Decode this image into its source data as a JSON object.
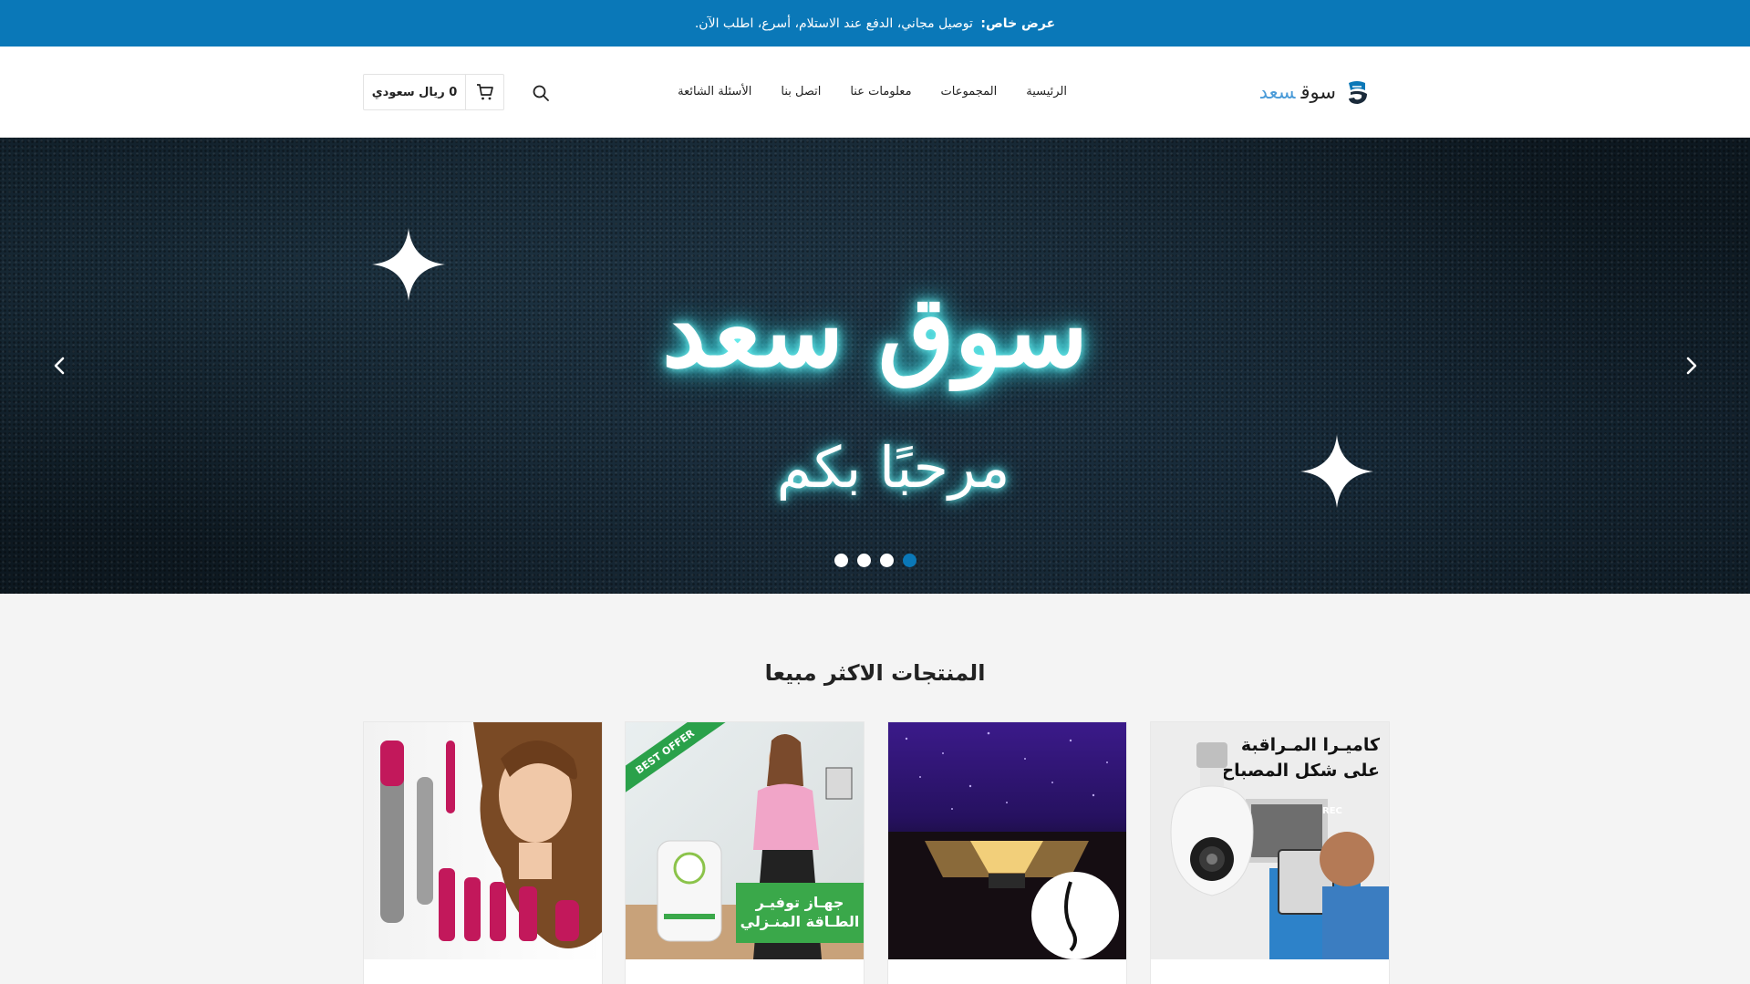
{
  "announcement": {
    "prefix": "عرض خاص:",
    "text": " توصيل مجاني، الدفع عند الاستلام، أسرع، اطلب الآن."
  },
  "logo": {
    "word1": "سوق",
    "word2": "سعد"
  },
  "nav": {
    "items": [
      {
        "label": "الرئيسية"
      },
      {
        "label": "المجموعات"
      },
      {
        "label": "معلومات عنا"
      },
      {
        "label": "اتصل بنا"
      },
      {
        "label": "الأسئلة الشائعة"
      }
    ]
  },
  "cart": {
    "total": "0 ريال سعودي"
  },
  "hero": {
    "title": "سوق سعد",
    "subtitle": "مرحبًا بكم",
    "slides_count": 4,
    "active_slide": 4
  },
  "best_sellers": {
    "title": "المنتجات الاكثر مبيعا",
    "products": [
      {
        "image_text_line1": "كاميـرا المـراقبة",
        "image_text_line2": "على شكل المصباح",
        "badge": "REC"
      },
      {
        "image_text": ""
      },
      {
        "ribbon": "BEST OFFER",
        "image_text_line1": "جهـاز توفيـر",
        "image_text_line2": "الطـاقة المنـزلي"
      },
      {
        "image_text": ""
      }
    ]
  },
  "colors": {
    "accent": "#0a78b8",
    "logo_accent": "#4a9bd8",
    "glow": "#39d6e0"
  },
  "icons": [
    "search-icon",
    "cart-icon",
    "chevron-left-icon",
    "chevron-right-icon",
    "logo-icon",
    "sparkle-icon"
  ]
}
